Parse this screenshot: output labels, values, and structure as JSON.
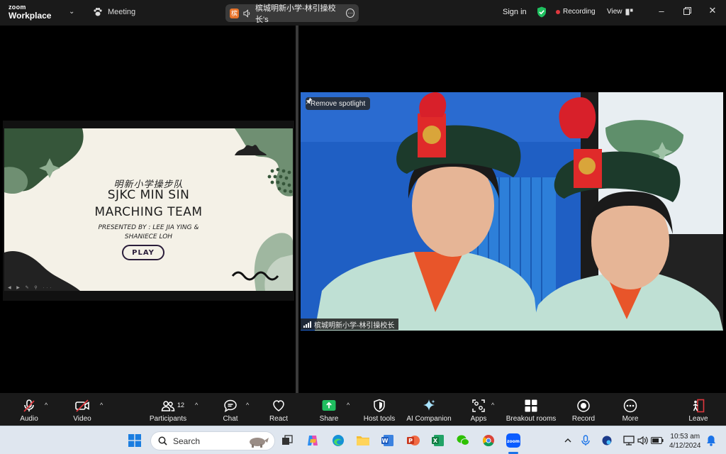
{
  "title_bar": {
    "logo_line1": "zoom",
    "logo_line2": "Workplace",
    "meeting_label": "Meeting",
    "meeting_name": "槟城明新小学-林引操校长's",
    "avatar_letter": "槟",
    "sign_in": "Sign in",
    "recording": "Recording",
    "view": "View"
  },
  "slide": {
    "title_cn": "明新小学操步队",
    "title_line1": "SJKC MIN SIN",
    "title_line2": "MARCHING TEAM",
    "presenter_line1": "PRESENTED BY :  LEE JIA YING &",
    "presenter_line2": "SHANIECE LOH",
    "play": "PLAY"
  },
  "video": {
    "remove_spotlight": "Remove spotlight",
    "participant_name": "槟城明新小学-林引操校长"
  },
  "toolbar": {
    "audio": "Audio",
    "video": "Video",
    "participants": "Participants",
    "participants_count": "12",
    "chat": "Chat",
    "react": "React",
    "share": "Share",
    "host_tools": "Host tools",
    "ai_companion": "AI Companion",
    "apps": "Apps",
    "breakout_rooms": "Breakout rooms",
    "record": "Record",
    "more": "More",
    "leave": "Leave"
  },
  "taskbar": {
    "search_placeholder": "Search",
    "time": "10:53 am",
    "date": "4/12/2024"
  },
  "colors": {
    "recording_dot": "#e0383e",
    "share_green": "#1fbf5f",
    "leave_red": "#e0383e",
    "slide_green": "#36563a"
  }
}
